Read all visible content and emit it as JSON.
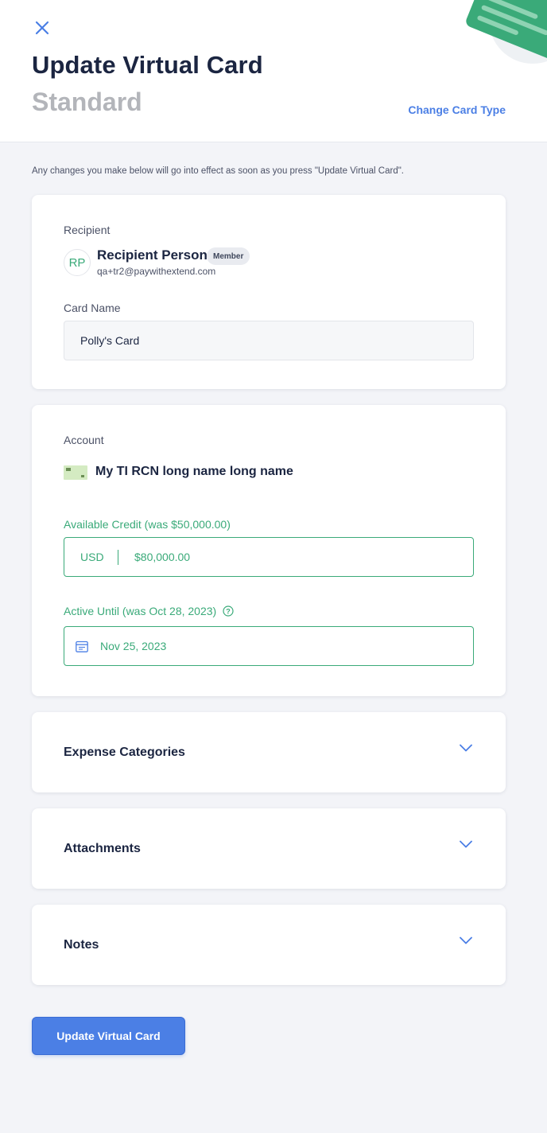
{
  "header": {
    "title": "Update Virtual Card",
    "subtitle": "Standard",
    "change_type_label": "Change Card Type",
    "close_icon": "close-icon"
  },
  "intro_text": "Any changes you make below will go into effect as soon as you press \"Update Virtual Card\".",
  "recipient": {
    "label": "Recipient",
    "initials": "RP",
    "name": "Recipient Person",
    "badge": "Member",
    "email": "qa+tr2@paywithextend.com"
  },
  "card_name": {
    "label": "Card Name",
    "value": "Polly's Card"
  },
  "account": {
    "label": "Account",
    "name": "My TI RCN long name long name",
    "icon": "credit-card-icon"
  },
  "available_credit": {
    "label": "Available Credit (was $50,000.00)",
    "currency": "USD",
    "value": "$80,000.00"
  },
  "active_until": {
    "label": "Active Until (was Oct 28, 2023)",
    "value": "Nov 25, 2023",
    "info_icon": "info-icon",
    "calendar_icon": "calendar-icon"
  },
  "sections": [
    {
      "title": "Expense Categories"
    },
    {
      "title": "Attachments"
    },
    {
      "title": "Notes"
    }
  ],
  "submit_label": "Update Virtual Card",
  "colors": {
    "primary": "#4b7fe5",
    "green": "#3aaa79",
    "navy": "#1b2541",
    "background": "#f3f4f8"
  }
}
